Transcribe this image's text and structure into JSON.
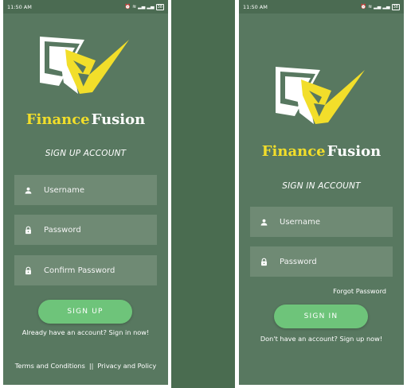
{
  "status_bar": {
    "time": "11:50 AM",
    "icons": [
      "alarm-icon",
      "wifi-icon",
      "signal-icon",
      "signal-icon",
      "battery-icon"
    ],
    "battery": "38"
  },
  "brand": {
    "part1": "Finance",
    "part2": "Fusion",
    "colors": {
      "part1": "#f2de2a",
      "part2": "#ffffff"
    }
  },
  "signup": {
    "heading": "SIGN UP ACCOUNT",
    "username_placeholder": "Username",
    "password_placeholder": "Password",
    "confirm_password_placeholder": "Confirm Password",
    "button_label": "SIGN UP",
    "signin_link": "Already have an account? Sign in now!",
    "terms": "Terms and Conditions",
    "separator": "||",
    "privacy": "Privacy and Policy"
  },
  "signin": {
    "heading": "SIGN IN ACCOUNT",
    "username_placeholder": "Username",
    "password_placeholder": "Password",
    "forgot_password": "Forgot Password",
    "button_label": "SIGN IN",
    "signup_link": "Don't have an account? Sign up now!"
  },
  "colors": {
    "background": "#587860",
    "status_bar": "#4b6b52",
    "field": "#6f8a74",
    "button": "#6ec47a",
    "logo_yellow": "#f2de2a"
  }
}
